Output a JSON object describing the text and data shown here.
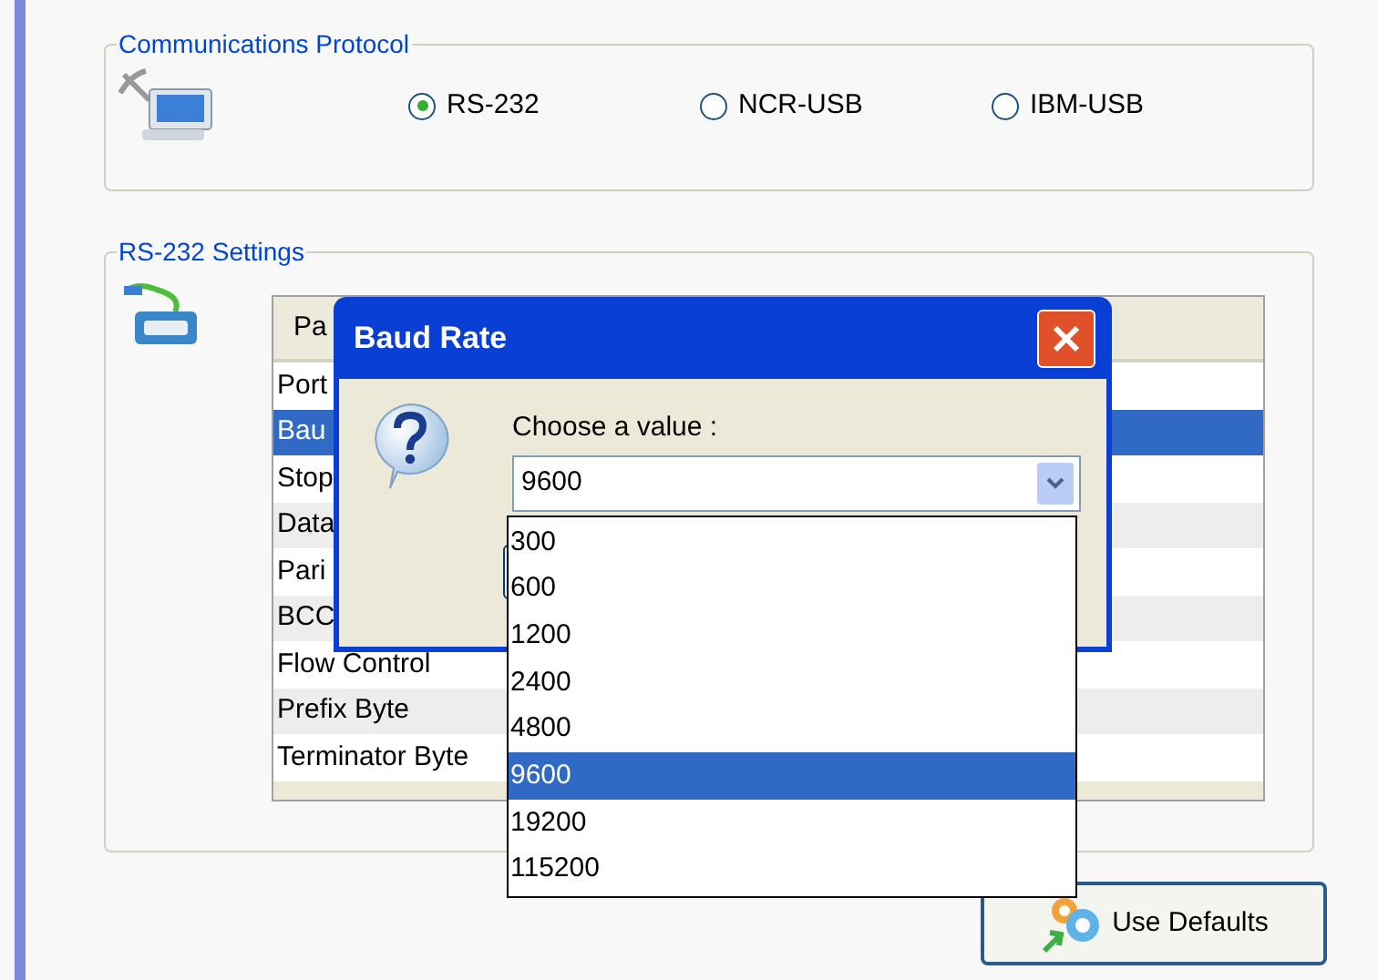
{
  "protocol": {
    "title": "Communications Protocol",
    "options": [
      {
        "label": "RS-232",
        "selected": true
      },
      {
        "label": "NCR-USB",
        "selected": false
      },
      {
        "label": "IBM-USB",
        "selected": false
      }
    ]
  },
  "settings": {
    "title": "RS-232 Settings",
    "table": {
      "column_1": "Pa",
      "rows": [
        {
          "label": "Port",
          "selected": false
        },
        {
          "label": "Bau",
          "selected": true
        },
        {
          "label": "Stop",
          "selected": false
        },
        {
          "label": "Data",
          "selected": false
        },
        {
          "label": "Pari",
          "selected": false
        },
        {
          "label": "BCC",
          "selected": false
        },
        {
          "label": "Flow Control",
          "selected": false
        },
        {
          "label": "Prefix Byte",
          "selected": false
        },
        {
          "label": "Terminator Byte",
          "selected": false
        }
      ]
    }
  },
  "dialog": {
    "title": "Baud Rate",
    "prompt": "Choose a value :",
    "value": "9600",
    "options": [
      {
        "label": "300",
        "selected": false
      },
      {
        "label": "600",
        "selected": false
      },
      {
        "label": "1200",
        "selected": false
      },
      {
        "label": "2400",
        "selected": false
      },
      {
        "label": "4800",
        "selected": false
      },
      {
        "label": "9600",
        "selected": true
      },
      {
        "label": "19200",
        "selected": false
      },
      {
        "label": "115200",
        "selected": false
      }
    ]
  },
  "buttons": {
    "defaults": "Use Defaults"
  }
}
